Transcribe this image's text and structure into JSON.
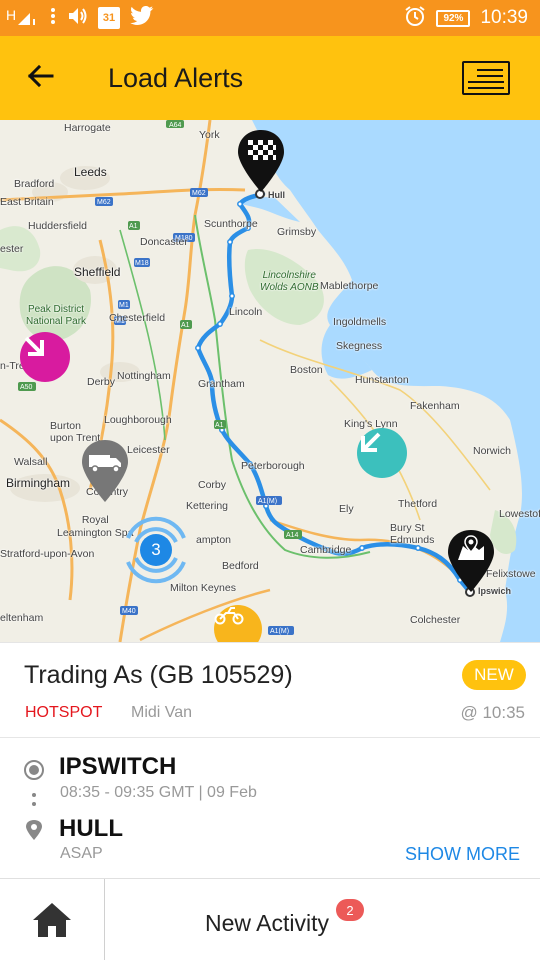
{
  "status_bar": {
    "calendar_day": "31",
    "battery": "92%",
    "time": "10:39",
    "icons": [
      "signal-h-icon",
      "more-vert-icon",
      "volume-icon",
      "calendar-icon",
      "twitter-icon",
      "alarm-icon",
      "battery-icon"
    ]
  },
  "header": {
    "title": "Load Alerts",
    "back_icon": "arrow-left-icon",
    "list_icon": "list-view-icon"
  },
  "map": {
    "places": {
      "harrogate": "Harrogate",
      "york": "York",
      "leeds": "Leeds",
      "bradford": "Bradford",
      "east_britain": "East Britain",
      "huddersfield": "Huddersfield",
      "doncaster": "Doncaster",
      "scunthorpe": "Scunthorpe",
      "grimsby": "Grimsby",
      "hull": "Hull",
      "sheffield": "Sheffield",
      "peak_district": "Peak District\nNational Park",
      "chesterfield": "Chesterfield",
      "lincoln": "Lincoln",
      "lincolnshire_wolds": "Lincolnshire\nWolds AONB",
      "mablethorpe": "Mablethorpe",
      "ingoldmells": "Ingoldmells",
      "skegness": "Skegness",
      "derby": "Derby",
      "nottingham": "Nottingham",
      "grantham": "Grantham",
      "boston": "Boston",
      "hunstanton": "Hunstanton",
      "fakenham": "Fakenham",
      "loughborough": "Loughborough",
      "burton": "Burton\nupon Trent",
      "kings_lynn": "King's Lynn",
      "norwich": "Norwich",
      "walsall": "Walsall",
      "leicester": "Leicester",
      "peterborough": "Peterborough",
      "birmingham": "Birmingham",
      "coventry": "Coventry",
      "corby": "Corby",
      "thetford": "Thetford",
      "lowestoft": "Lowestoft",
      "royal_leamington": "Royal\nLeamington Spa",
      "kettering": "Kettering",
      "northampton": "ampton",
      "ely": "Ely",
      "bury_st_edmunds": "Bury St\nEdmunds",
      "stratford": "Stratford-upon-Avon",
      "cambridge": "Cambridge",
      "ipswich": "Ipswich",
      "felixstowe": "Felixstowe",
      "bedford": "Bedford",
      "milton_keynes": "Milton Keynes",
      "colchester": "Colchester",
      "cheltenham": "eltenham",
      "newcastle_under": "n-Tre",
      "chester_edge": "ester"
    },
    "road_labels": [
      "A64",
      "M62",
      "A1",
      "M180",
      "M18",
      "M1",
      "A1",
      "A50",
      "A14",
      "A1(M)",
      "M40",
      "A1(M)",
      "A14"
    ],
    "cluster_count": "3",
    "markers": [
      "checkered-flag-pin-icon",
      "map-pin-icon",
      "truck-pin-icon",
      "arrow-down-right-marker-icon",
      "arrow-down-left-marker-icon",
      "motorbike-marker-icon"
    ],
    "colors": {
      "route": "#2b8fe6",
      "sea": "#aadaff",
      "land": "#f1efe6",
      "park": "#cfe3c4",
      "magenta_marker": "#d81b9f",
      "teal_marker": "#3cc0bd",
      "orange_marker": "#f8b51c"
    }
  },
  "load": {
    "company": "Trading As (GB 105529)",
    "status_badge": "NEW",
    "tag": "HOTSPOT",
    "vehicle": "Midi Van",
    "posted_time": "@ 10:35",
    "origin": {
      "name": "IPSWITCH",
      "window": "08:35 - 09:35 GMT | 09 Feb"
    },
    "destination": {
      "name": "HULL",
      "window": "ASAP"
    },
    "show_more": "SHOW MORE"
  },
  "bottom_nav": {
    "home_icon": "home-icon",
    "activity_label": "New Activity",
    "activity_count": "2"
  },
  "colors": {
    "status_bar": "#f7941d",
    "app_bar": "#ffc20e",
    "accent_blue": "#1e88e5",
    "hotspot_red": "#e4161d",
    "badge_red": "#ec5a58"
  }
}
